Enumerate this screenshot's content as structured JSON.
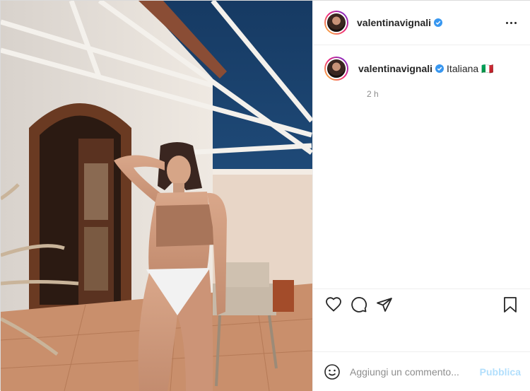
{
  "post": {
    "username": "valentinavignali",
    "verified": true,
    "more_icon": "more-options-icon"
  },
  "caption": {
    "username": "valentinavignali",
    "text": "Italiana 🇮🇹",
    "time": "2 h"
  },
  "actions": {
    "like_icon": "heart-icon",
    "comment_icon": "comment-icon",
    "share_icon": "share-icon",
    "save_icon": "bookmark-icon"
  },
  "comment_box": {
    "placeholder": "Aggiungi un commento...",
    "publish_label": "Pubblica",
    "emoji_icon": "emoji-icon"
  },
  "colors": {
    "sky": "#1f4f82",
    "link_disabled": "#b2dffc",
    "verified": "#3897f0"
  }
}
